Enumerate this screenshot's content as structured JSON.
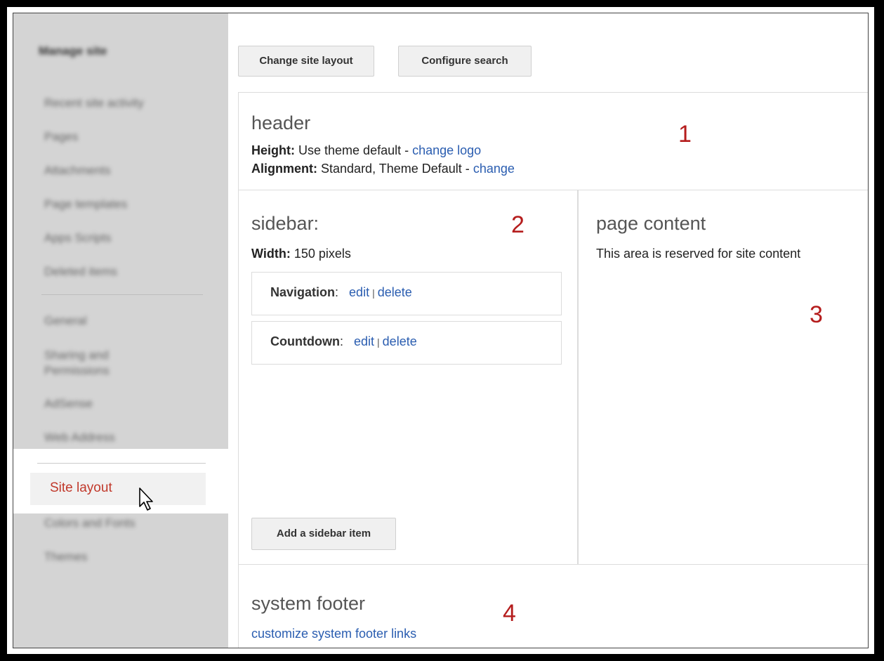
{
  "sidebar": {
    "title": "Manage site",
    "items_group1": [
      "Recent site activity",
      "Pages",
      "Attachments",
      "Page templates",
      "Apps Scripts",
      "Deleted items"
    ],
    "items_group2": [
      "General",
      "Sharing and Permissions",
      "AdSense",
      "Web Address"
    ],
    "active_item": "Site layout",
    "items_group3": [
      "Colors and Fonts",
      "Themes"
    ]
  },
  "toolbar": {
    "change_layout_label": "Change site layout",
    "configure_search_label": "Configure search"
  },
  "header_panel": {
    "title": "header",
    "height_label": "Height:",
    "height_value": "Use theme default - ",
    "height_link": "change logo",
    "alignment_label": "Alignment:",
    "alignment_value": "Standard, Theme Default - ",
    "alignment_link": "change",
    "number": "1"
  },
  "sidebar_panel": {
    "title": "sidebar:",
    "width_label": "Width:",
    "width_value": "150 pixels",
    "number": "2",
    "gadgets": [
      {
        "name": "Navigation",
        "edit": "edit",
        "delete": "delete"
      },
      {
        "name": "Countdown",
        "edit": "edit",
        "delete": "delete"
      }
    ],
    "add_label": "Add a sidebar item"
  },
  "content_panel": {
    "title": "page content",
    "description": "This area is reserved for site content",
    "number": "3"
  },
  "footer_panel": {
    "title": "system footer",
    "link": "customize system footer links",
    "number": "4"
  },
  "colors": {
    "link": "#2a5db0",
    "active_sidebar_text": "#c1392b",
    "annotation_number": "#b51d1d"
  }
}
